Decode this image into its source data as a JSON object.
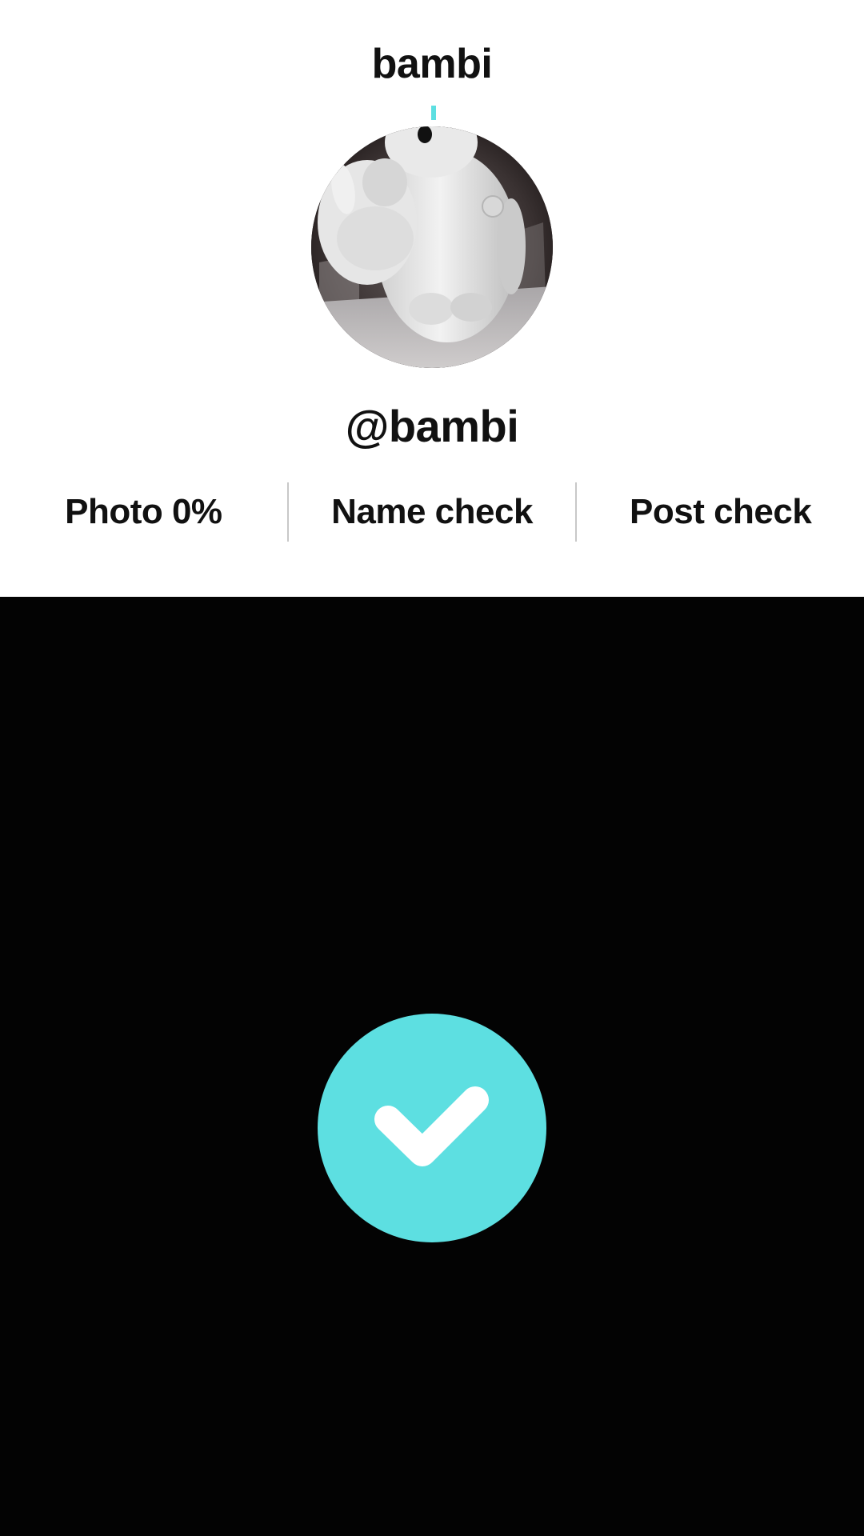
{
  "header": {
    "title": "bambi"
  },
  "profile": {
    "handle": "@bambi",
    "avatar_icon": "avatar-photo-white-robot"
  },
  "stats": {
    "items": [
      {
        "label": "Photo 0%"
      },
      {
        "label": "Name check"
      },
      {
        "label": "Post check"
      }
    ]
  },
  "action": {
    "icon": "checkmark-icon",
    "color": "#5ddfe1"
  },
  "colors": {
    "accent": "#5ddfe1",
    "top_bg": "#ffffff",
    "bottom_bg": "#030303"
  }
}
